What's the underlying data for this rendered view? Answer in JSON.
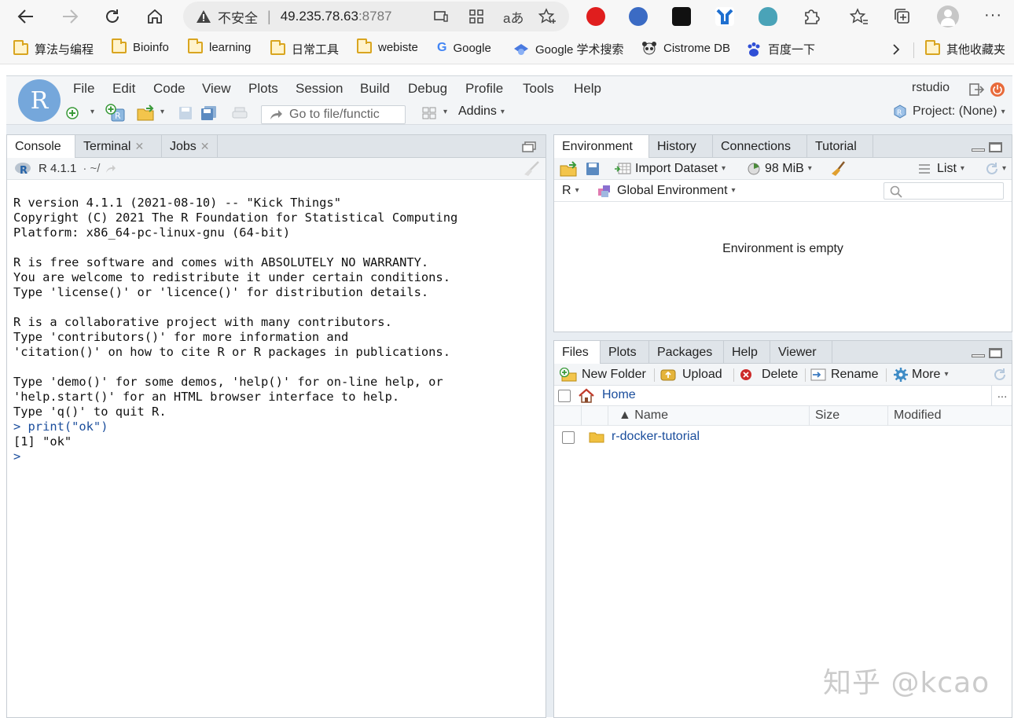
{
  "browser": {
    "insecure_label": "不安全",
    "url_host": "49.235.78.63",
    "url_port": ":8787",
    "bookmarks": [
      {
        "label": "算法与编程",
        "icon": "folder-icon"
      },
      {
        "label": "Bioinfo",
        "icon": "folder-icon"
      },
      {
        "label": "learning",
        "icon": "folder-icon"
      },
      {
        "label": "日常工具",
        "icon": "folder-icon"
      },
      {
        "label": "webiste",
        "icon": "folder-icon"
      },
      {
        "label": "Google",
        "icon": "google-icon"
      },
      {
        "label": "Google 学术搜索",
        "icon": "scholar-icon"
      },
      {
        "label": "Cistrome DB",
        "icon": "panda-icon"
      },
      {
        "label": "百度一下",
        "icon": "baidu-icon"
      }
    ],
    "other_bookmarks": "其他收藏夹"
  },
  "rstudio": {
    "logo": "R",
    "menu": [
      "File",
      "Edit",
      "Code",
      "View",
      "Plots",
      "Session",
      "Build",
      "Debug",
      "Profile",
      "Tools",
      "Help"
    ],
    "user": "rstudio",
    "goto_placeholder": "Go to file/functic",
    "addins": "Addins",
    "project": "Project: (None)"
  },
  "console": {
    "tabs": [
      {
        "label": "Console"
      },
      {
        "label": "Terminal"
      },
      {
        "label": "Jobs"
      }
    ],
    "version_label": "R 4.1.1",
    "path": "· ~/",
    "startup": "R version 4.1.1 (2021-08-10) -- \"Kick Things\"\nCopyright (C) 2021 The R Foundation for Statistical Computing\nPlatform: x86_64-pc-linux-gnu (64-bit)\n\nR is free software and comes with ABSOLUTELY NO WARRANTY.\nYou are welcome to redistribute it under certain conditions.\nType 'license()' or 'licence()' for distribution details.\n\nR is a collaborative project with many contributors.\nType 'contributors()' for more information and\n'citation()' on how to cite R or R packages in publications.\n\nType 'demo()' for some demos, 'help()' for on-line help, or\n'help.start()' for an HTML browser interface to help.\nType 'q()' to quit R.\n",
    "command": "> print(\"ok\")",
    "output": "[1] \"ok\"",
    "prompt": ">"
  },
  "env": {
    "tabs": [
      "Environment",
      "History",
      "Connections",
      "Tutorial"
    ],
    "import_dataset": "Import Dataset",
    "memory": "98 MiB",
    "view_mode": "List",
    "language": "R",
    "scope": "Global Environment",
    "empty_message": "Environment is empty"
  },
  "files": {
    "tabs": [
      "Files",
      "Plots",
      "Packages",
      "Help",
      "Viewer"
    ],
    "new_folder": "New Folder",
    "upload": "Upload",
    "delete": "Delete",
    "rename": "Rename",
    "more": "More",
    "breadcrumb": "Home",
    "ellipsis": "...",
    "columns": {
      "name": "▲ Name",
      "size": "Size",
      "modified": "Modified"
    },
    "rows": [
      {
        "name": "r-docker-tutorial",
        "size": "",
        "modified": ""
      }
    ]
  },
  "watermark": "知乎 @kcao",
  "colors": {
    "r_blue": "#75a7db",
    "link_blue": "#1a4d9c",
    "folder_yellow": "#f0c040"
  }
}
